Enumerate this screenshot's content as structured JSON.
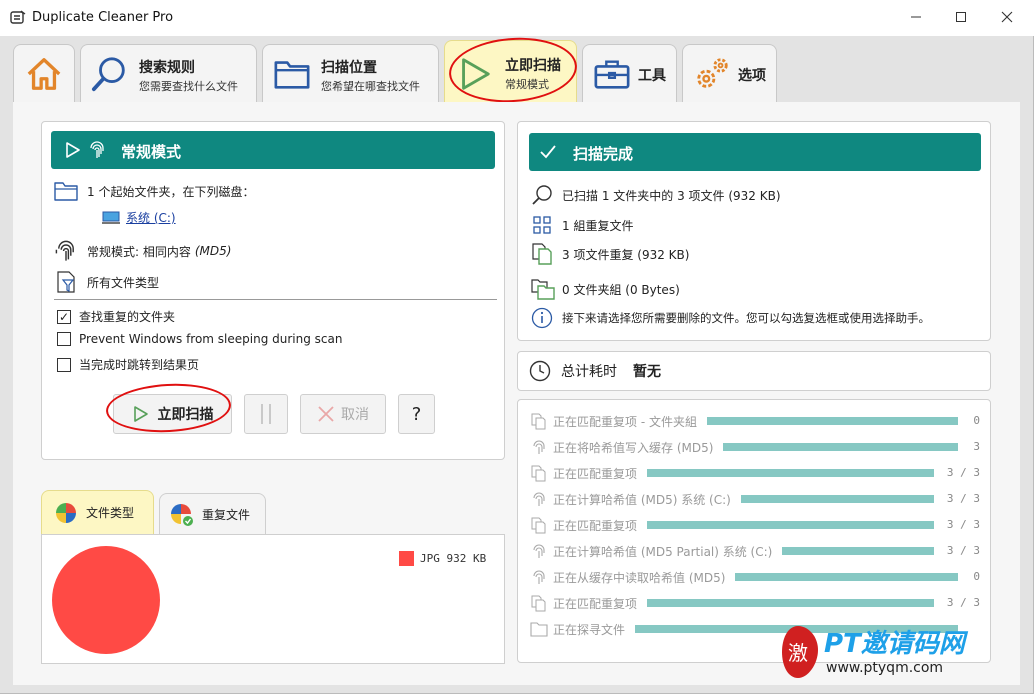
{
  "window": {
    "title": "Duplicate Cleaner Pro"
  },
  "tabs": [
    {
      "icon": "home-icon",
      "title": "",
      "subtitle": ""
    },
    {
      "icon": "search-icon",
      "title": "搜索规则",
      "subtitle": "您需要查找什么文件"
    },
    {
      "icon": "folder-icon",
      "title": "扫描位置",
      "subtitle": "您希望在哪查找文件"
    },
    {
      "icon": "play-icon",
      "title": "立即扫描",
      "subtitle": "常规模式"
    },
    {
      "icon": "toolbox-icon",
      "title": "工具",
      "subtitle": ""
    },
    {
      "icon": "gear-icon",
      "title": "选项",
      "subtitle": ""
    }
  ],
  "left_panel": {
    "header": "常规模式",
    "start_folders": "1 个起始文件夹，在下列磁盘：",
    "drive": "系统 (C:)",
    "mode": "常规模式: 相同内容",
    "mode_suffix": "(MD5)",
    "file_types": "所有文件类型",
    "options": [
      {
        "label": "查找重复的文件夹",
        "checked": true
      },
      {
        "label": "Prevent Windows from sleeping during scan",
        "checked": false
      },
      {
        "label": "当完成时跳转到结果页",
        "checked": false
      }
    ],
    "scan_button": "立即扫描",
    "cancel_button": "取消",
    "help_button": "?"
  },
  "right_panel": {
    "header": "扫描完成",
    "stats": [
      {
        "icon": "search-icon",
        "text": "已扫描 1 文件夹中的 3 项文件 (932 KB)"
      },
      {
        "icon": "grid-icon",
        "text": "1 組重复文件"
      },
      {
        "icon": "duplicate-files-icon",
        "text": "3 项文件重复 (932 KB)"
      },
      {
        "icon": "duplicate-folders-icon",
        "text": "0 文件夹組 (0 Bytes)"
      },
      {
        "icon": "info-icon",
        "text": "接下来请选择您所需要删除的文件。您可以勾选复选框或使用选择助手。"
      }
    ]
  },
  "time_panel": {
    "label": "总计耗时",
    "value": "暂无"
  },
  "progress": [
    {
      "icon": "duplicate-files-icon",
      "label": "正在匹配重复项 - 文件夹組",
      "value": "0",
      "fill": 1.0
    },
    {
      "icon": "fingerprint-icon",
      "label": "正在将哈希值写入缓存 (MD5)",
      "value": "3",
      "fill": 1.0
    },
    {
      "icon": "duplicate-files-icon",
      "label": "正在匹配重复项",
      "value": "3 / 3",
      "fill": 1.0
    },
    {
      "icon": "fingerprint-icon",
      "label": "正在计算哈希值 (MD5) 系统 (C:)",
      "value": "3 / 3",
      "fill": 1.0
    },
    {
      "icon": "duplicate-files-icon",
      "label": "正在匹配重复项",
      "value": "3 / 3",
      "fill": 1.0
    },
    {
      "icon": "fingerprint-icon",
      "label": "正在计算哈希值 (MD5 Partial) 系统 (C:)",
      "value": "3 / 3",
      "fill": 1.0
    },
    {
      "icon": "fingerprint-icon",
      "label": "正在从缓存中读取哈希值 (MD5)",
      "value": "0",
      "fill": 1.0
    },
    {
      "icon": "duplicate-files-icon",
      "label": "正在匹配重复项",
      "value": "3 / 3",
      "fill": 1.0
    },
    {
      "icon": "folder-icon",
      "label": "正在探寻文件",
      "value": "",
      "fill": 1.0
    }
  ],
  "bottom_tabs": [
    {
      "label": "文件类型"
    },
    {
      "label": "重复文件"
    }
  ],
  "chart_data": {
    "type": "pie",
    "categories": [
      "JPG"
    ],
    "values": [
      932
    ],
    "legend": [
      {
        "type": "JPG",
        "size": "932 KB",
        "color": "#ff4a45"
      }
    ]
  },
  "watermark": {
    "title": "PT邀请码网",
    "url": "www.ptyqm.com"
  },
  "colors": {
    "teal": "#0f8880",
    "active_tab": "#fdf7c4",
    "pie": "#ff4a45",
    "bar": "#86c8c3"
  }
}
